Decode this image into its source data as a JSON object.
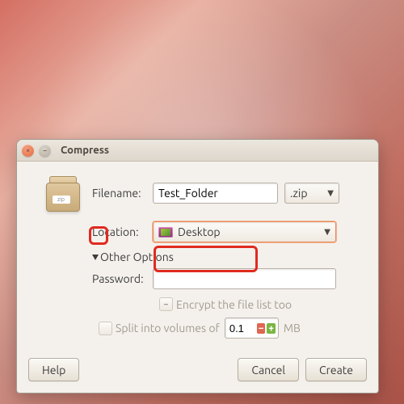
{
  "window": {
    "title": "Compress"
  },
  "form": {
    "filename_label": "Filename:",
    "filename_value": "Test_Folder",
    "ext_label": ".zip",
    "location_label": "Location:",
    "location_value": "Desktop",
    "expander_label": "Other Options",
    "password_label": "Password:",
    "password_value": "",
    "encrypt_label": "Encrypt the file list too",
    "encrypt_checked": "−",
    "split_label_a": "Split into volumes of",
    "split_value": "0.1",
    "split_label_b": "MB"
  },
  "buttons": {
    "help": "Help",
    "cancel": "Cancel",
    "create": "Create"
  },
  "icons": {
    "zip_label": "zip"
  }
}
